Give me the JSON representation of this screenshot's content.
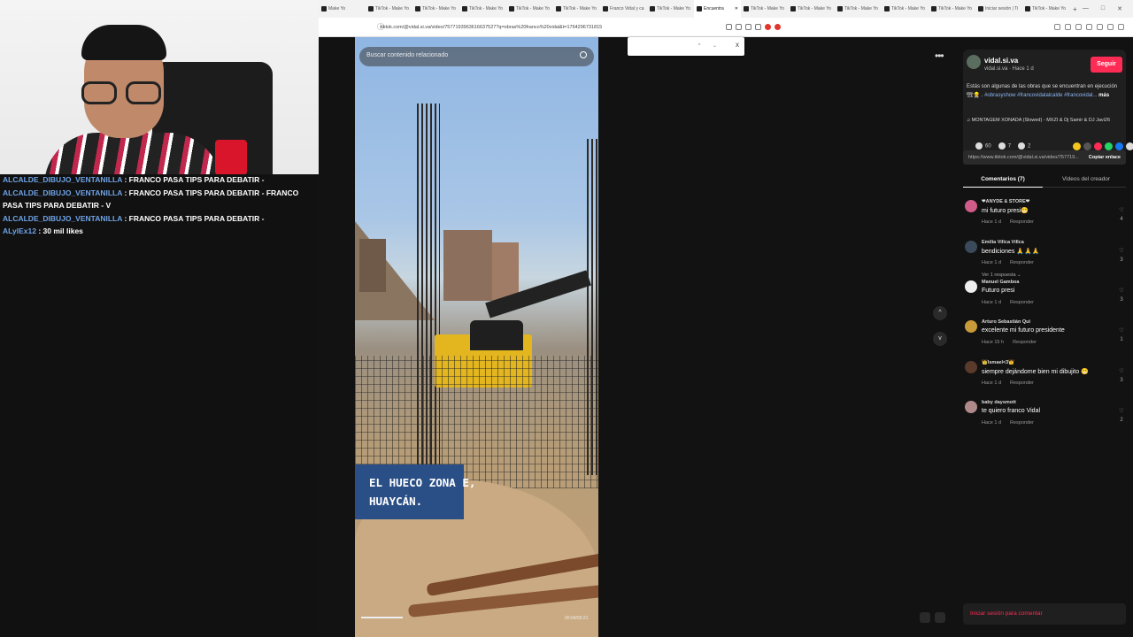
{
  "stream": {
    "chat": [
      {
        "user": "ALCALDE_DIBUJO_VENTANILLA",
        "text": ": FRANCO PASA TIPS PARA DEBATIR -"
      },
      {
        "user": "ALCALDE_DIBUJO_VENTANILLA",
        "text": ": FRANCO PASA TIPS PARA DEBATIR - FRANCO PASA TIPS PARA DEBATIR - V"
      },
      {
        "user": "ALCALDE_DIBUJO_VENTANILLA",
        "text": ": FRANCO PASA TIPS PARA DEBATIR -"
      },
      {
        "user": "ALylEx12",
        "text": ": 30 mil likes"
      }
    ]
  },
  "browser": {
    "tabs": [
      {
        "label": "Make Yo"
      },
      {
        "label": "TikTok - Make Yo"
      },
      {
        "label": "TikTok - Make Yo"
      },
      {
        "label": "TikTok - Make Yo"
      },
      {
        "label": "TikTok - Make Yo"
      },
      {
        "label": "TikTok - Make Yo"
      },
      {
        "label": "Franco Vidal y ca"
      },
      {
        "label": "TikTok - Make Yo"
      },
      {
        "label": "Encuentra",
        "active": true
      },
      {
        "label": "TikTok - Make Yo"
      },
      {
        "label": "TikTok - Make Yo"
      },
      {
        "label": "TikTok - Make Yo"
      },
      {
        "label": "TikTok - Make Yo"
      },
      {
        "label": "TikTok - Make Yo"
      },
      {
        "label": "Iniciar sesión | Ti"
      },
      {
        "label": "TikTok - Make Yo"
      }
    ],
    "new_tab": "+",
    "window_controls": {
      "minimize": "—",
      "maximize": "□",
      "close": "✕"
    },
    "url": "tiktok.com/@vidal.si.va/video/7577193963616637527?q=obras%20franco%20vidal&t=1764296731815",
    "find_box": {
      "close": "x"
    }
  },
  "video": {
    "search_placeholder": "Buscar contenido relacionado",
    "caption": "EL HUECO ZONA E,\nHUAYCÁN.",
    "time": "00:04/00:21",
    "progress": 0.18,
    "more": "•••",
    "up": "^",
    "down": "v"
  },
  "post": {
    "author": "vidal.si.va",
    "author_sub": "vidal.si.va · Hace 1 d",
    "follow": "Seguir",
    "desc_text": "Estás son algunas de las obras que se encuentran en ejecución 🏗👷 . ",
    "desc_tags": "#obrasyshow #francovidalalcalde #francovidal...",
    "desc_more": "más",
    "music": "♫ MONTAGEM XONADA (Slowed) - MXZI & Dj Samir & DJ Javi26",
    "likes": "60",
    "comments_count": "7",
    "saves": "2",
    "share_colors": [
      "#f5c518",
      "#555555",
      "#fe2c55",
      "#25d366",
      "#1877f2",
      "#dddddd"
    ],
    "link": "https://www.tiktok.com/@vidal.si.va/video/757719...",
    "copy": "Copiar enlace",
    "tab_comments": "Comentarios (7)",
    "tab_creator": "Videos del creador",
    "login": "Iniciar sesión para comentar"
  },
  "comments": [
    {
      "name": "❤ANYDE & STORE❤",
      "text": "mi futuro presi😁",
      "time": "Hace 1 d",
      "reply": "Responder",
      "likes": "4"
    },
    {
      "name": "Emilia Villca Villca",
      "text": "bendiciones 🙏🙏🙏",
      "time": "Hace 1 d",
      "reply": "Responder",
      "likes": "3",
      "more": "Ver 1 respuesta ⌄"
    },
    {
      "name": "Manuel Gamboa",
      "text": "Futuro presi",
      "time": "Hace 1 d",
      "reply": "Responder",
      "likes": "3"
    },
    {
      "name": "Arturo Sebastián Qui",
      "text": "excelente mi futuro presidente",
      "time": "Hace 15 h",
      "reply": "Responder",
      "likes": "1"
    },
    {
      "name": "👑Ismael<3👑",
      "text": "siempre dejándome bien mi dibujito 😁",
      "time": "Hace 1 d",
      "reply": "Responder",
      "likes": "3"
    },
    {
      "name": "baby daysmott",
      "text": "te quiero franco Vidal",
      "time": "Hace 1 d",
      "reply": "Responder",
      "likes": "2"
    }
  ]
}
